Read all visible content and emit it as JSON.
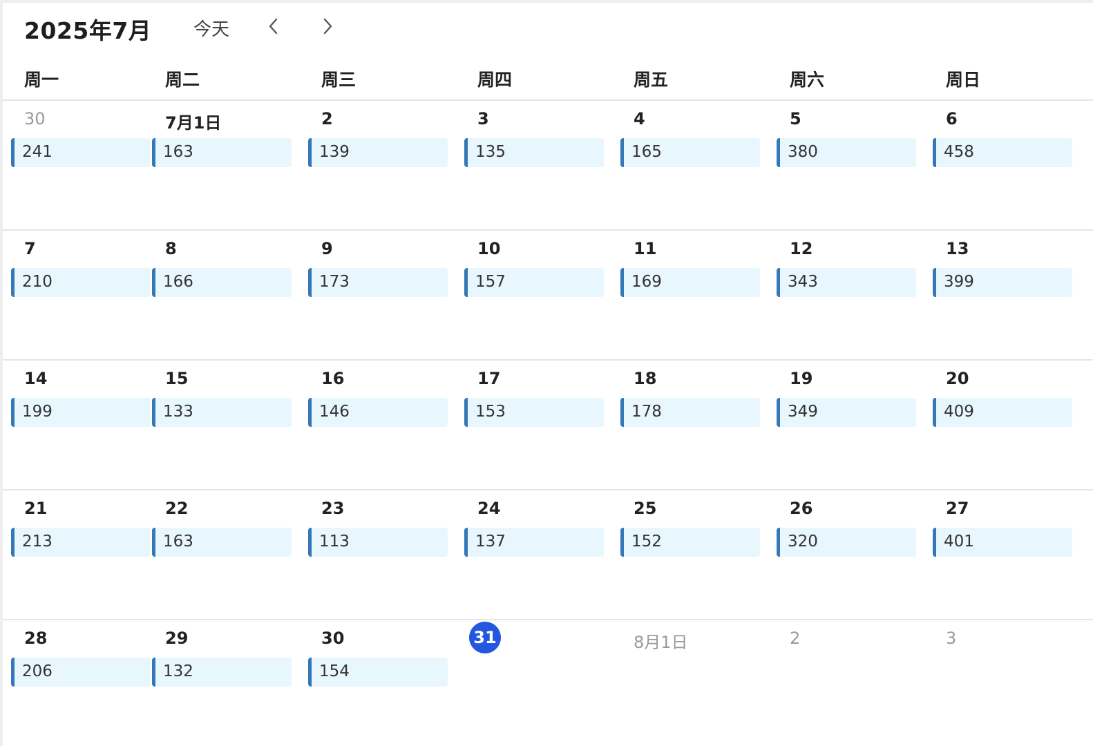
{
  "header": {
    "month_title": "2025年7月",
    "today_label": "今天",
    "prev_icon": "chevron-left-icon",
    "next_icon": "chevron-right-icon"
  },
  "weekdays": [
    "周一",
    "周二",
    "周三",
    "周四",
    "周五",
    "周六",
    "周日"
  ],
  "colors": {
    "event_bg": "#e8f6fd",
    "event_bar": "#3478b8",
    "today_circle": "#2357e0",
    "muted_text": "#9a9a9a",
    "grid_line": "#e6e6e6"
  },
  "weeks": [
    [
      {
        "label": "30",
        "muted": true,
        "event": "241"
      },
      {
        "label": "7月1日",
        "event": "163"
      },
      {
        "label": "2",
        "event": "139"
      },
      {
        "label": "3",
        "event": "135"
      },
      {
        "label": "4",
        "event": "165"
      },
      {
        "label": "5",
        "event": "380"
      },
      {
        "label": "6",
        "event": "458"
      }
    ],
    [
      {
        "label": "7",
        "event": "210"
      },
      {
        "label": "8",
        "event": "166"
      },
      {
        "label": "9",
        "event": "173"
      },
      {
        "label": "10",
        "event": "157"
      },
      {
        "label": "11",
        "event": "169"
      },
      {
        "label": "12",
        "event": "343"
      },
      {
        "label": "13",
        "event": "399"
      }
    ],
    [
      {
        "label": "14",
        "event": "199"
      },
      {
        "label": "15",
        "event": "133"
      },
      {
        "label": "16",
        "event": "146"
      },
      {
        "label": "17",
        "event": "153"
      },
      {
        "label": "18",
        "event": "178"
      },
      {
        "label": "19",
        "event": "349"
      },
      {
        "label": "20",
        "event": "409"
      }
    ],
    [
      {
        "label": "21",
        "event": "213"
      },
      {
        "label": "22",
        "event": "163"
      },
      {
        "label": "23",
        "event": "113"
      },
      {
        "label": "24",
        "event": "137"
      },
      {
        "label": "25",
        "event": "152"
      },
      {
        "label": "26",
        "event": "320"
      },
      {
        "label": "27",
        "event": "401"
      }
    ],
    [
      {
        "label": "28",
        "event": "206"
      },
      {
        "label": "29",
        "event": "132"
      },
      {
        "label": "30",
        "event": "154"
      },
      {
        "label": "31",
        "today": true
      },
      {
        "label": "8月1日",
        "muted": true
      },
      {
        "label": "2",
        "muted": true
      },
      {
        "label": "3",
        "muted": true
      }
    ]
  ]
}
